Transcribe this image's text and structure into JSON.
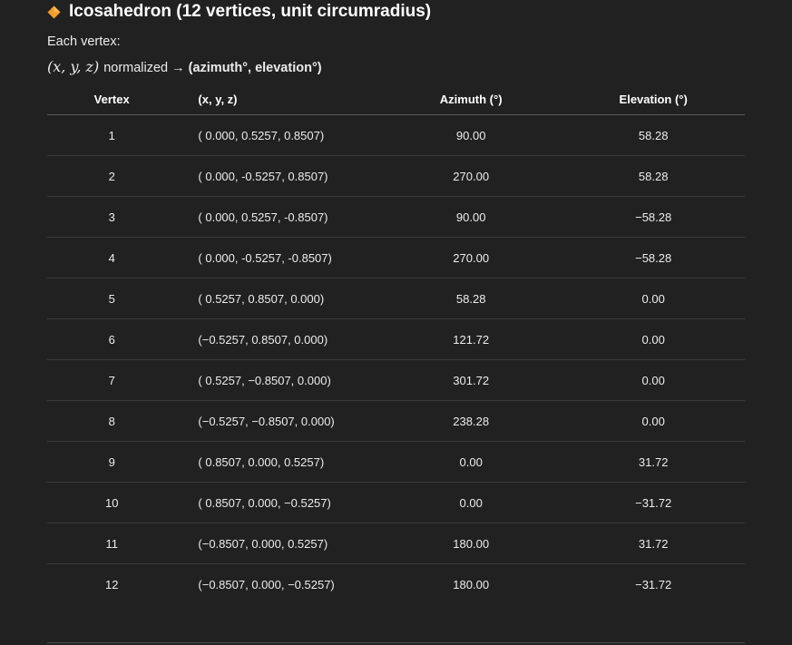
{
  "heading": {
    "icon": "orange-diamond-icon",
    "icon_color": "#f59e2b",
    "title": "Icosahedron (12 vertices, unit circumradius)"
  },
  "intro": "Each vertex:",
  "formula": {
    "math": "(x, y, z)",
    "text": "normalized",
    "arrow": "→",
    "result": "(azimuth°, elevation°)"
  },
  "table": {
    "headers": [
      "Vertex",
      "(x, y, z)",
      "Azimuth (°)",
      "Elevation (°)"
    ],
    "rows": [
      [
        "1",
        "( 0.000, 0.5257, 0.8507)",
        "90.00",
        "58.28"
      ],
      [
        "2",
        "( 0.000, -0.5257, 0.8507)",
        "270.00",
        "58.28"
      ],
      [
        "3",
        "( 0.000, 0.5257, -0.8507)",
        "90.00",
        "−58.28"
      ],
      [
        "4",
        "( 0.000, -0.5257, -0.8507)",
        "270.00",
        "−58.28"
      ],
      [
        "5",
        "( 0.5257, 0.8507, 0.000)",
        "58.28",
        "0.00"
      ],
      [
        "6",
        "(−0.5257, 0.8507, 0.000)",
        "121.72",
        "0.00"
      ],
      [
        "7",
        "( 0.5257, −0.8507, 0.000)",
        "301.72",
        "0.00"
      ],
      [
        "8",
        "(−0.5257, −0.8507, 0.000)",
        "238.28",
        "0.00"
      ],
      [
        "9",
        "( 0.8507, 0.000, 0.5257)",
        "0.00",
        "31.72"
      ],
      [
        "10",
        "( 0.8507, 0.000, −0.5257)",
        "0.00",
        "−31.72"
      ],
      [
        "11",
        "(−0.8507, 0.000, 0.5257)",
        "180.00",
        "31.72"
      ],
      [
        "12",
        "(−0.8507, 0.000, −0.5257)",
        "180.00",
        "−31.72"
      ]
    ]
  }
}
